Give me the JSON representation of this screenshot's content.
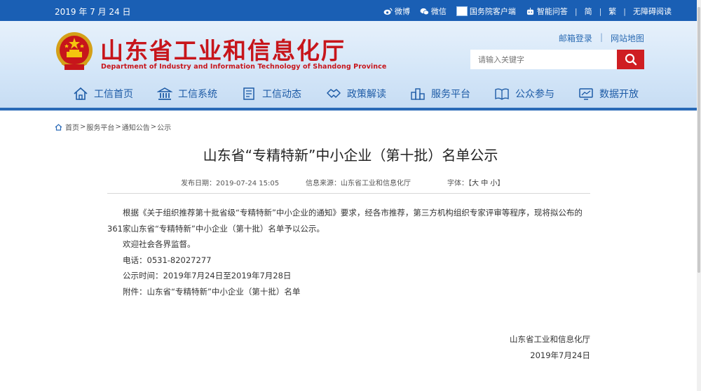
{
  "topbar": {
    "date": "2019 年 7 月 24 日",
    "weibo": "微博",
    "weixin": "微信",
    "gov_client": "国务院客户端",
    "smart_qa": "智能问答",
    "simplified": "简",
    "traditional": "繁",
    "accessible": "无障碍阅读"
  },
  "header": {
    "site_name_cn": "山东省工业和信息化厅",
    "site_name_en": "Department of Industry and Information Technology of Shandong Province",
    "mail_login": "邮箱登录",
    "site_map": "网站地图",
    "search_placeholder": "请输入关键字"
  },
  "nav": [
    {
      "label": "工信首页",
      "icon": "home-icon"
    },
    {
      "label": "工信系统",
      "icon": "building-icon"
    },
    {
      "label": "工信动态",
      "icon": "document-icon"
    },
    {
      "label": "政策解读",
      "icon": "handshake-icon"
    },
    {
      "label": "服务平台",
      "icon": "city-icon"
    },
    {
      "label": "公众参与",
      "icon": "book-icon"
    },
    {
      "label": "数据开放",
      "icon": "data-screen-icon"
    }
  ],
  "breadcrumb": [
    "首页",
    "服务平台",
    "通知公告",
    "公示"
  ],
  "article": {
    "title": "山东省“专精特新”中小企业（第十批）名单公示",
    "publish_date": "发布日期：2019-07-24 15:05",
    "source": "信息来源：山东省工业和信息化厅",
    "font_label": "字体：",
    "font_open": "【",
    "font_large": "大",
    "font_medium": "中",
    "font_small": "小",
    "font_close": "】",
    "para1_line1": "根据《关于组织推荐第十批省级“专精特新”中小企业的通知》要求，经各市推荐，第三方机构组织专家评审等程序，现将拟公布的",
    "para1_line2": "361家山东省“专精特新”中小企业（第十批）名单予以公示。",
    "para2": "欢迎社会各界监督。",
    "phone": "电话：0531-82027277",
    "period": "公示时间：2019年7月24日至2019年7月28日",
    "attachment": "附件：山东省“专精特新”中小企业（第十批）名单",
    "signature": "山东省工业和信息化厅",
    "sign_date": "2019年7月24日"
  },
  "colors": {
    "topbar_bg": "#1a5fb4",
    "brand_red": "#c7151b",
    "nav_text": "#1d5ba6",
    "search_button": "#cf1e22"
  }
}
